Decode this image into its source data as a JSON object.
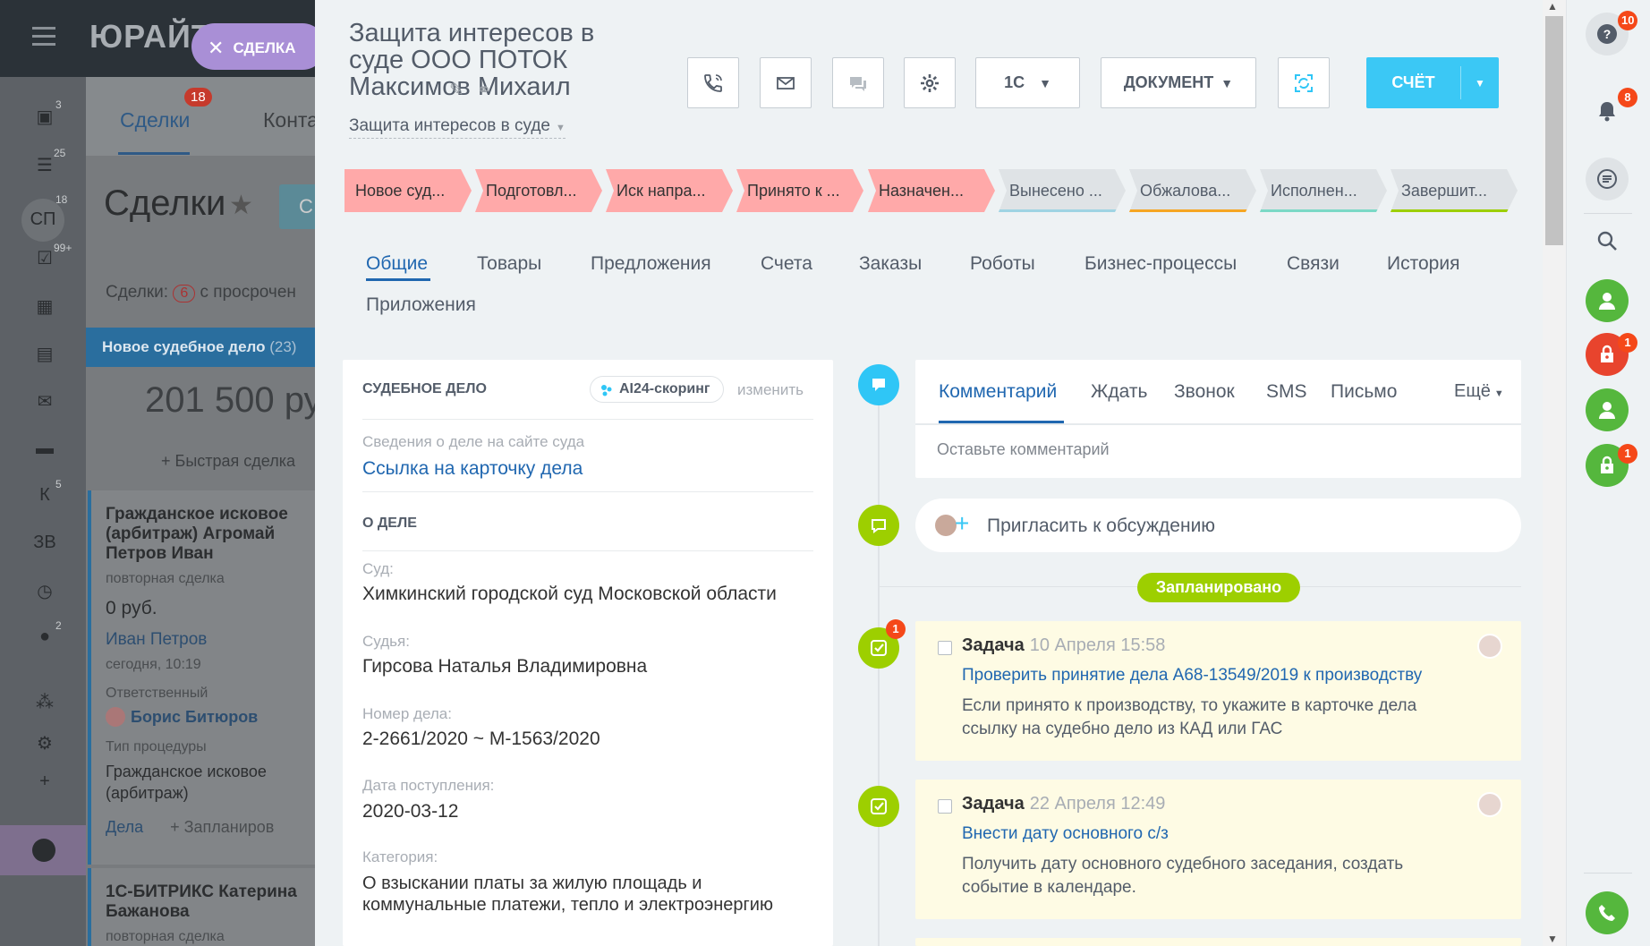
{
  "background": {
    "logo": "ЮРАЙТ",
    "deal_pill": "СДЕЛКА",
    "tabs": [
      {
        "label": "Сделки",
        "badge": "18"
      },
      {
        "label": "Конта"
      }
    ],
    "page_title": "Сделки",
    "chip_text": "С",
    "filter_text": "Сделки:",
    "filter_count": "6",
    "filter_suffix": "с просрочен",
    "column_title": "Новое судебное дело",
    "column_count": "(23)",
    "column_sum": "201 500 ру",
    "quick_deal": "+ Быстрая сделка",
    "left_badges": [
      "3",
      "25",
      "18",
      "99+",
      "5",
      "2"
    ],
    "left_labels": [
      "СП",
      "К",
      "ЗВ"
    ],
    "cards": [
      {
        "title": "Гражданское исковое (арбитраж) Агромай Петров Иван",
        "type": "повторная сделка",
        "amount": "0 руб.",
        "client": "Иван Петров",
        "date": "сегодня, 10:19",
        "responsible_label": "Ответственный",
        "responsible": "Борис Битюров",
        "procedure_label": "Тип процедуры",
        "procedure": "Гражданское исковое (арбитраж)",
        "actions": "Дела",
        "planned": "+ Запланиров"
      },
      {
        "title": "1С-БИТРИКС Катерина Бажанова",
        "type": "повторная сделка"
      }
    ]
  },
  "header": {
    "title": "Защита интересов в суде ООО ПОТОК Максимов Михаил",
    "subtitle": "Защита интересов в суде",
    "buttons": {
      "onec": "1С",
      "document": "ДОКУМЕНТ",
      "sale": "СЧЁТ"
    }
  },
  "stages": [
    {
      "label": "Новое суд...",
      "color": "#ffa9a9",
      "done": true
    },
    {
      "label": "Подготовл...",
      "color": "#ffa9a9",
      "done": true
    },
    {
      "label": "Иск напра...",
      "color": "#ffa9a9",
      "done": true
    },
    {
      "label": "Принято к ...",
      "color": "#ffa9a9",
      "done": true
    },
    {
      "label": "Назначен...",
      "color": "#ffa9a9",
      "done": true
    },
    {
      "label": "Вынесено ...",
      "color": "#9fd4e3",
      "done": false
    },
    {
      "label": "Обжалова...",
      "color": "#f6a623",
      "done": false
    },
    {
      "label": "Исполнен...",
      "color": "#7bd9c6",
      "done": false
    },
    {
      "label": "Завершит...",
      "color": "#9dcf00",
      "done": false
    }
  ],
  "tabs": [
    "Общие",
    "Товары",
    "Предложения",
    "Счета",
    "Заказы",
    "Роботы",
    "Бизнес-процессы",
    "Связи",
    "История",
    "Приложения"
  ],
  "card": {
    "heading": "СУДЕБНОЕ ДЕЛО",
    "ai_badge": "AI24-скоринг",
    "change": "изменить",
    "court_site_label": "Сведения о деле на сайте суда",
    "court_site_link": "Ссылка на карточку дела",
    "about_heading": "О ДЕЛЕ",
    "fields": [
      {
        "label": "Суд:",
        "value": "Химкинский городской суд Московской области"
      },
      {
        "label": "Судья:",
        "value": "Гирсова Наталья Владимировна"
      },
      {
        "label": "Номер дела:",
        "value": "2-2661/2020 ~ М-1563/2020"
      },
      {
        "label": "Дата поступления:",
        "value": "2020-03-12"
      },
      {
        "label": "Категория:",
        "value": "О взыскании платы за жилую площадь и коммунальные платежи, тепло и электроэнергию"
      }
    ]
  },
  "timeline": {
    "editor_tabs": [
      "Комментарий",
      "Ждать",
      "Звонок",
      "SMS",
      "Письмо",
      "Ещё"
    ],
    "editor_placeholder": "Оставьте комментарий",
    "invite": "Пригласить к обсуждению",
    "planned": "Запланировано",
    "tasks": [
      {
        "label": "Задача",
        "date": "10 Апреля 15:58",
        "title": "Проверить принятие дела А68-13549/2019 к производству",
        "desc": "Если принято к производству, то укажите в карточке дела ссылку на судебно дело из КАД или ГАС",
        "badge": "1"
      },
      {
        "label": "Задача",
        "date": "22 Апреля 12:49",
        "title": "Внести дату основного с/з",
        "desc": "Получить дату основного судебного заседания, создать событие в календаре."
      }
    ]
  },
  "rail": {
    "help_badge": "10",
    "notif_badge": "8",
    "lock1_badge": "1",
    "lock2_badge": "1"
  },
  "colors": {
    "accent": "#2067b0",
    "sale": "#3bc8f5",
    "green": "#9dcf00",
    "timeline_blue": "#2fc6f6",
    "red": "#f54819"
  }
}
